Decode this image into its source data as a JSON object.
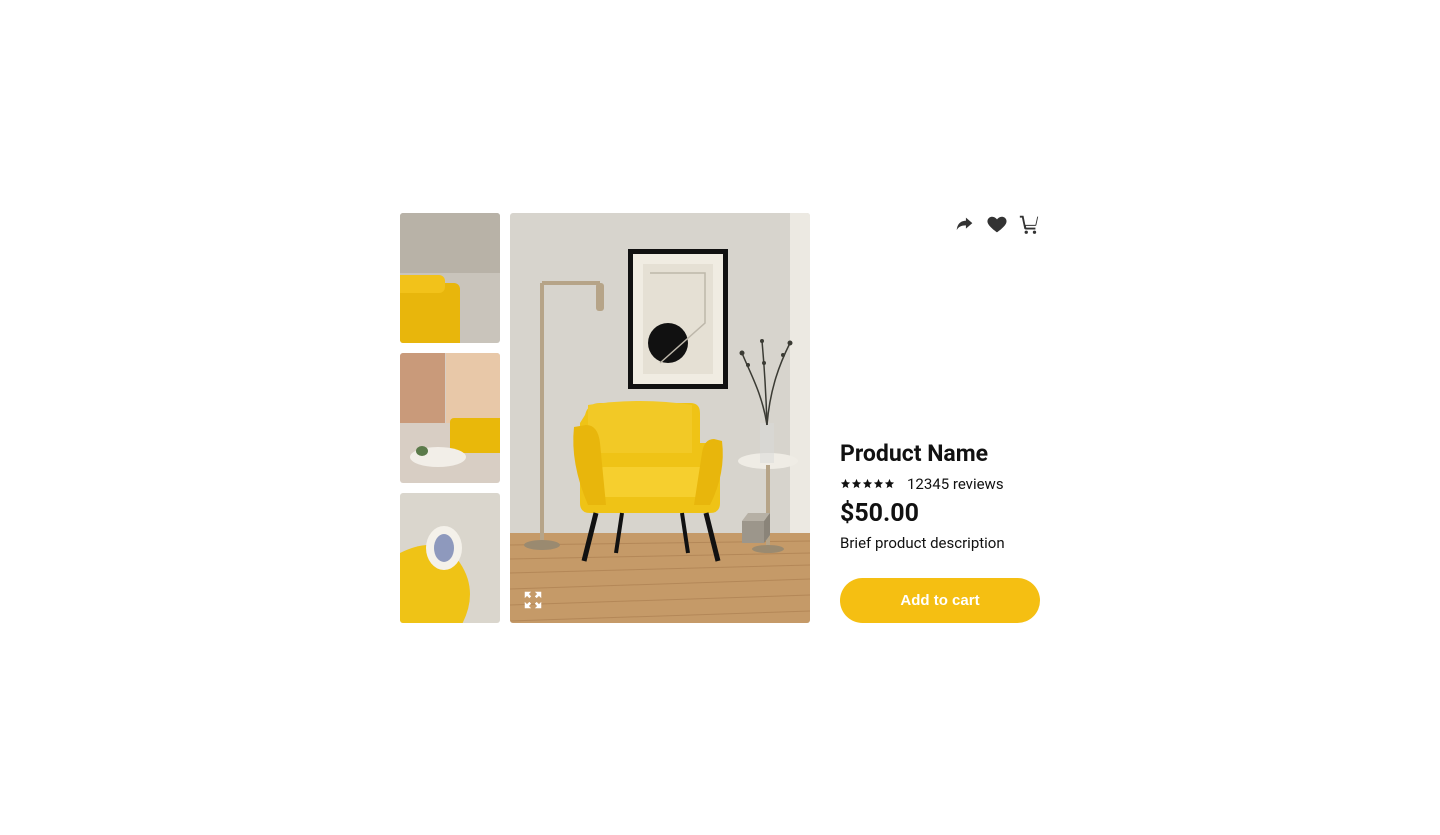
{
  "product": {
    "name": "Product Name",
    "review_count_text": "12345 reviews",
    "rating": 5,
    "price": "$50.00",
    "description": "Brief product description",
    "add_to_cart_label": "Add to cart"
  },
  "icons": {
    "share": "share-icon",
    "heart": "heart-icon",
    "cart": "cart-icon",
    "expand": "expand-icon"
  },
  "colors": {
    "accent": "#f5bf12"
  }
}
